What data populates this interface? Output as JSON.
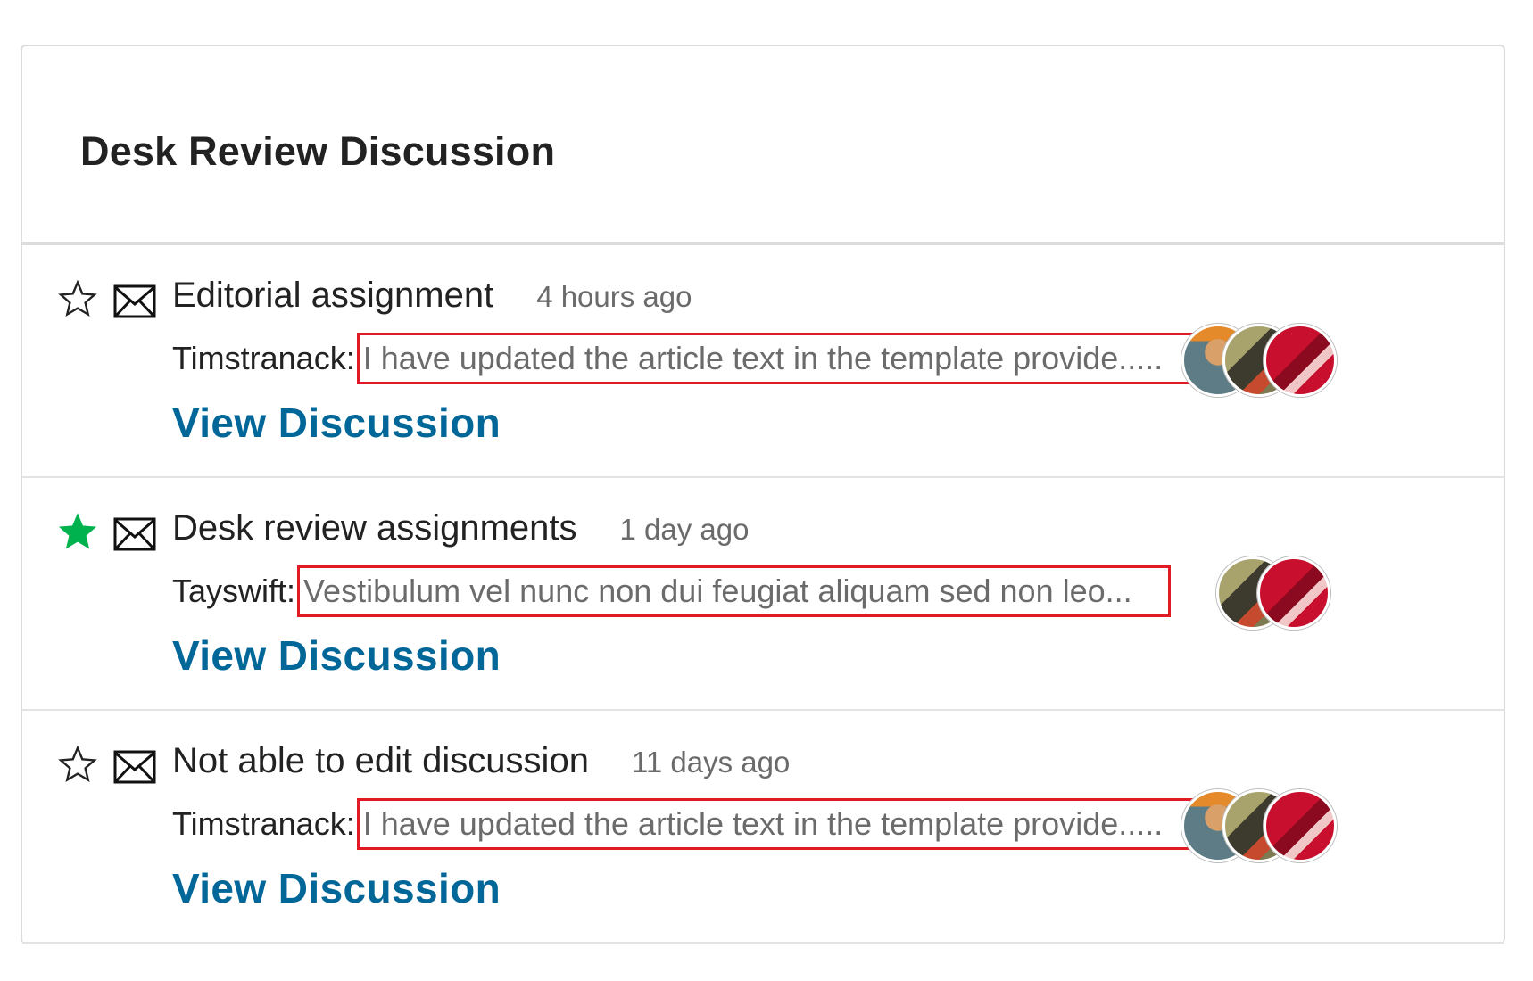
{
  "panel": {
    "title": "Desk Review Discussion"
  },
  "colors": {
    "link": "#006798",
    "starred": "#00b24e",
    "highlight_border": "#e01b24",
    "muted_text": "#6b6b6b"
  },
  "discussions": [
    {
      "title": "Editorial assignment",
      "time": "4 hours ago",
      "starred": false,
      "star_icon": "star-outline-icon",
      "mail_icon": "envelope-icon",
      "author": "Timstranack:",
      "preview": "I have updated the article text in the template provide.....",
      "link": "View Discussion",
      "participants": 3
    },
    {
      "title": "Desk review assignments",
      "time": "1 day ago",
      "starred": true,
      "star_icon": "star-filled-icon",
      "mail_icon": "envelope-icon",
      "author": "Tayswift:",
      "preview": "Vestibulum vel nunc non dui feugiat aliquam sed non leo...",
      "link": "View Discussion",
      "participants": 2
    },
    {
      "title": "Not able to edit discussion",
      "time": "11 days ago",
      "starred": false,
      "star_icon": "star-outline-icon",
      "mail_icon": "envelope-icon",
      "author": "Timstranack:",
      "preview": "I have updated the article text in the template provide.....",
      "link": "View Discussion",
      "participants": 3
    }
  ]
}
